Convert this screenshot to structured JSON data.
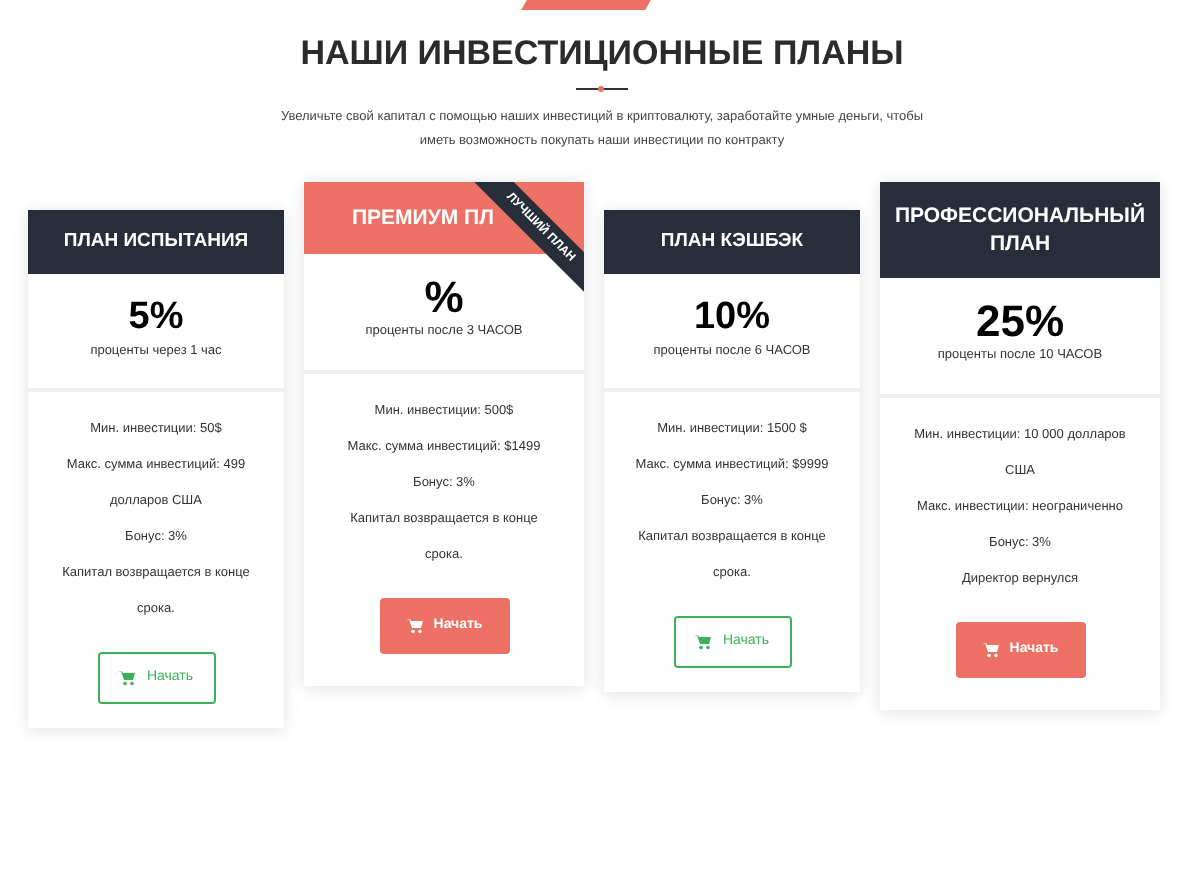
{
  "heading": "НАШИ ИНВЕСТИЦИОННЫЕ ПЛАНЫ",
  "intro": "Увеличьте свой капитал с помощью наших инвестиций в криптовалюту, заработайте умные деньги, чтобы иметь возможность покупать наши инвестиции по контракту",
  "plans": [
    {
      "title": "ПЛАН ИСПЫТАНИЯ",
      "featured": false,
      "rate": "5%",
      "rate_note": "проценты через 1 час",
      "features": [
        "Мин. инвестиции: 50$",
        "Макс. сумма инвестиций: 499 долларов США",
        "Бонус: 3%",
        "Капитал возвращается в конце срока."
      ],
      "button": "Начать"
    },
    {
      "title": "ПРЕМИУМ ПЛ",
      "featured": true,
      "ribbon": "ЛУЧШИЙ ПЛАН",
      "rate": "%",
      "rate_note": "проценты после 3 ЧАСОВ",
      "features": [
        "Мин. инвестиции: 500$",
        "Макс. сумма инвестиций: $1499",
        "Бонус: 3%",
        "Капитал возвращается в конце срока."
      ],
      "button": "Начать"
    },
    {
      "title": "ПЛАН КЭШБЭК",
      "featured": false,
      "rate": "10%",
      "rate_note": "проценты после 6 ЧАСОВ",
      "features": [
        "Мин. инвестиции: 1500 $",
        "Макс. сумма инвестиций: $9999",
        "Бонус: 3%",
        "Капитал возвращается в конце срока."
      ],
      "button": "Начать"
    },
    {
      "title": "ПРОФЕССИОНАЛЬНЫЙ ПЛАН",
      "featured": true,
      "rate": "25%",
      "rate_note": "проценты после 10 ЧАСОВ",
      "features": [
        "Мин. инвестиции: 10 000 долларов США",
        "Макс. инвестиции: неограниченно",
        "Бонус: 3%",
        "Директор вернулся"
      ],
      "button": "Начать"
    }
  ]
}
